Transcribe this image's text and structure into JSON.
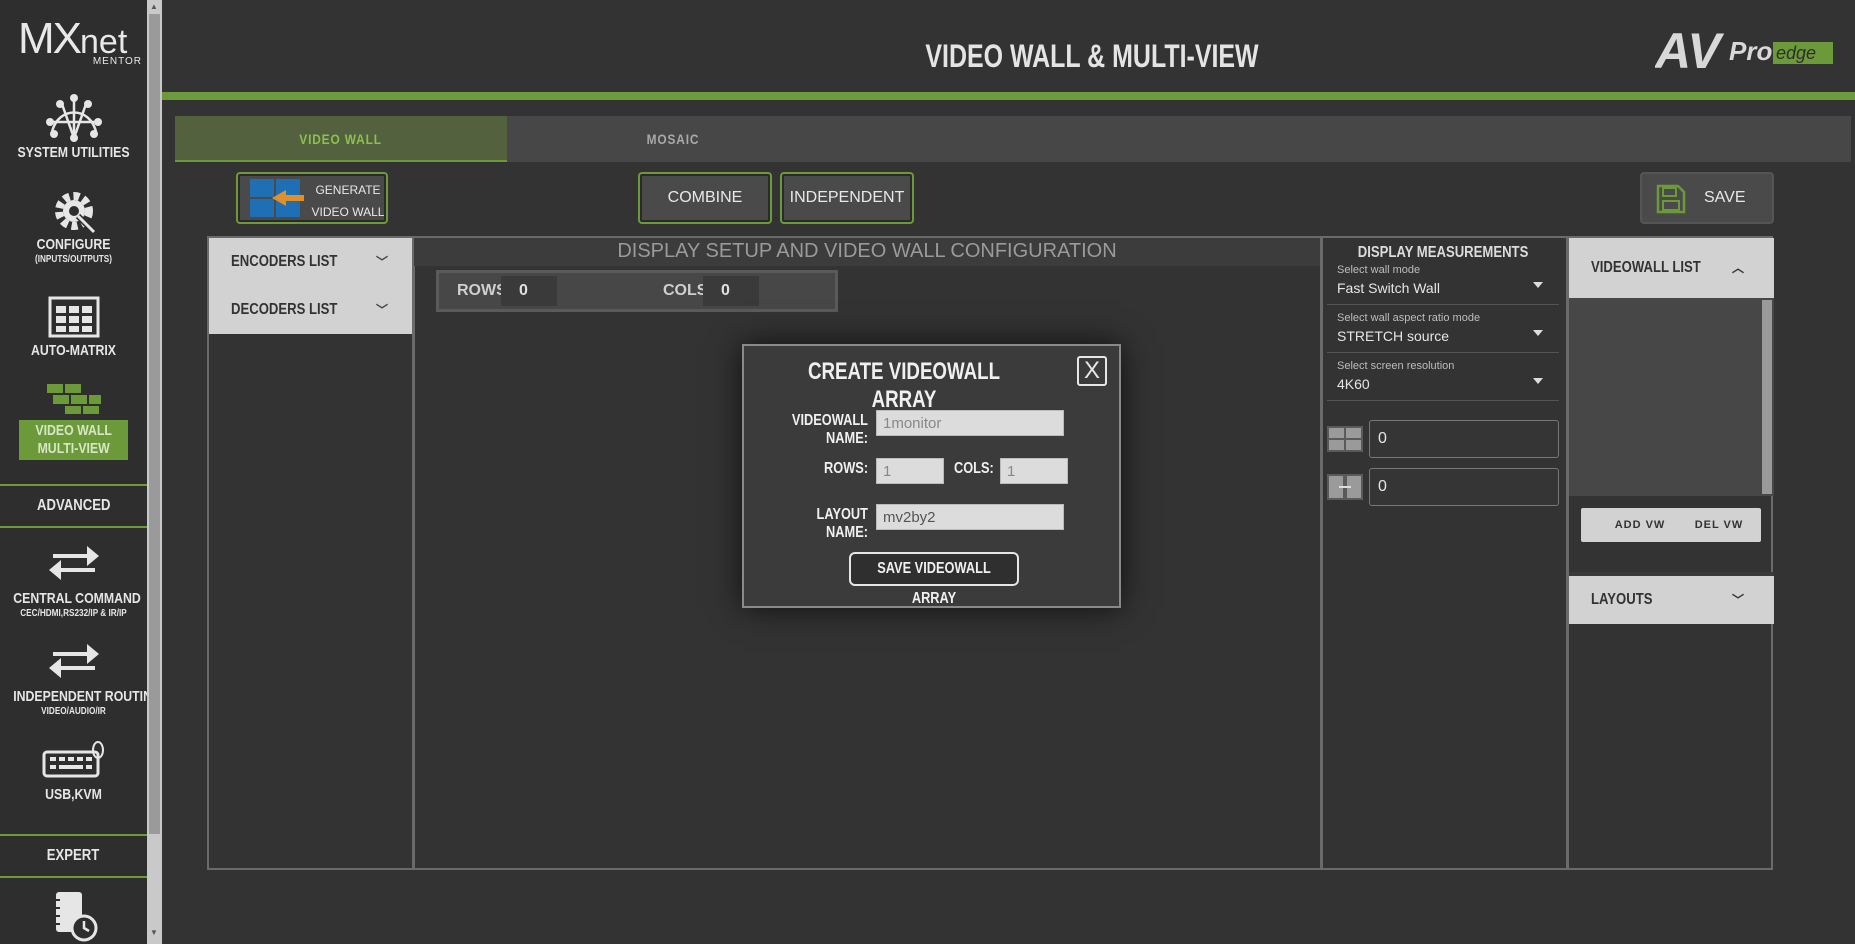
{
  "sidebar": {
    "logo_main": "MX",
    "logo_net": "net",
    "logo_sub": "MENTOR",
    "items": [
      {
        "label": "SYSTEM UTILITIES",
        "sub": ""
      },
      {
        "label": "CONFIGURE",
        "sub": "(INPUTS/OUTPUTS)"
      },
      {
        "label": "AUTO-MATRIX",
        "sub": ""
      },
      {
        "label": "VIDEO WALL",
        "label2": "MULTI-VIEW",
        "active": true
      },
      {
        "label": "CENTRAL COMMAND",
        "sub": "CEC/HDMI,RS232/IP & IR/IP"
      },
      {
        "label": "INDEPENDENT ROUTING",
        "sub": "VIDEO/AUDIO/IR"
      },
      {
        "label": "USB,KVM",
        "sub": ""
      }
    ],
    "sections": {
      "advanced": "ADVANCED",
      "expert": "EXPERT"
    }
  },
  "header": {
    "title": "VIDEO WALL & MULTI-VIEW",
    "brand_av": "AV",
    "brand_pro": "Pro",
    "brand_edge": "edge"
  },
  "tabs": [
    {
      "label": "VIDEO WALL",
      "active": true
    },
    {
      "label": "MOSAIC",
      "active": false
    }
  ],
  "toolbar": {
    "generate_line1": "GENERATE",
    "generate_line2": "VIDEO WALL",
    "combine": "COMBINE",
    "independent": "INDEPENDENT",
    "save": "SAVE"
  },
  "left_panel": {
    "encoders": "ENCODERS LIST",
    "decoders": "DECODERS LIST"
  },
  "center": {
    "title": "DISPLAY SETUP AND VIDEO WALL CONFIGURATION",
    "rows_label": "ROWS",
    "rows_value": "0",
    "cols_label": "COLS",
    "cols_value": "0"
  },
  "display_measurements": {
    "title": "DISPLAY MEASUREMENTS",
    "wall_mode_label": "Select wall mode",
    "wall_mode_value": "Fast Switch Wall",
    "aspect_label": "Select wall aspect ratio mode",
    "aspect_value": "STRETCH source",
    "resolution_label": "Select screen resolution",
    "resolution_value": "4K60",
    "measure1": "0",
    "measure2": "0"
  },
  "videowall_panel": {
    "list_title": "VIDEOWALL LIST",
    "add": "ADD VW",
    "del": "DEL VW",
    "layouts": "LAYOUTS"
  },
  "modal": {
    "title": "CREATE VIDEOWALL ARRAY",
    "close": "X",
    "name_label": "VIDEOWALL NAME:",
    "name_placeholder": "1monitor",
    "rows_label": "ROWS:",
    "rows_placeholder": "1",
    "cols_label": "COLS:",
    "cols_placeholder": "1",
    "layout_label": "LAYOUT NAME:",
    "layout_value": "mv2by2",
    "save_button": "SAVE VIDEOWALL ARRAY"
  },
  "colors": {
    "accent_green": "#6c9a3a",
    "background": "#333333",
    "panel_light": "#d2d2d2"
  }
}
